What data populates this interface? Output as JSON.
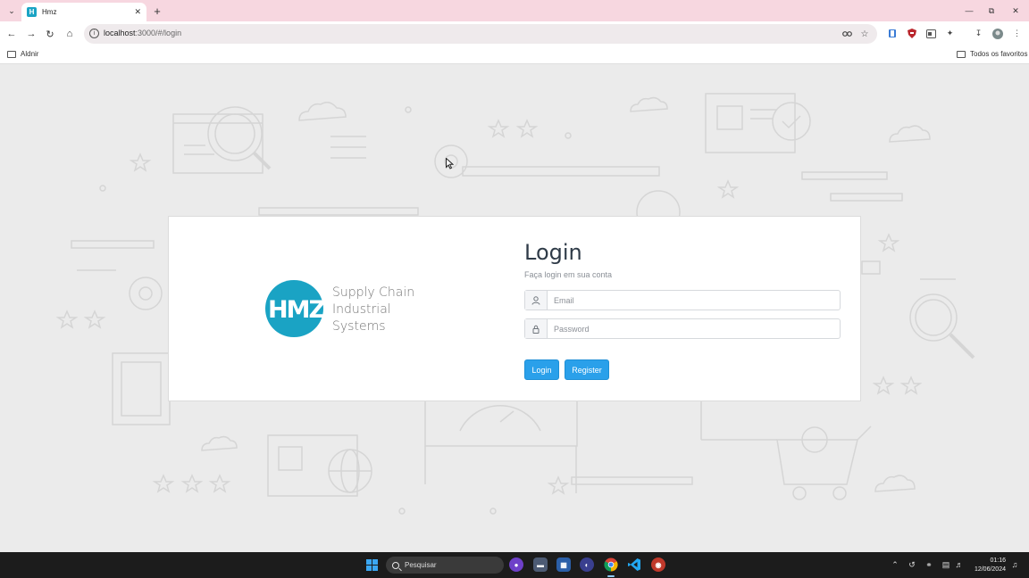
{
  "browser": {
    "tab_title": "Hmz",
    "tab_favicon": "H",
    "new_tab": "+",
    "url_host": "localhost",
    "url_rest": ":3000/#/login",
    "bookmark_left": "Aldnir",
    "bookmark_right": "Todos os favoritos",
    "icons": [
      "tab-search-icon",
      "close-icon",
      "back-arrow-icon",
      "forward-arrow-icon",
      "reload-icon",
      "home-icon",
      "site-info-icon",
      "password-key-icon",
      "star-icon",
      "extension-icon",
      "download-icon",
      "profile-avatar-icon",
      "menu-dots-icon"
    ]
  },
  "login_card": {
    "brand_logo_text": "HMZ",
    "brand_line1": "Supply Chain",
    "brand_line2": "Industrial",
    "brand_line3": "Systems",
    "title": "Login",
    "subtitle": "Faça login em sua conta",
    "email_placeholder": "Email",
    "email_value": "",
    "password_placeholder": "Password",
    "password_value": "",
    "login_button": "Login",
    "register_button": "Register"
  },
  "taskbar": {
    "search_label": "Pesquisar",
    "time": "01:16",
    "date": "12/06/2024"
  },
  "colors": {
    "tab_strip": "#f7d7e0",
    "brand_teal": "#1aa3c4",
    "primary_button": "#2aa0ea",
    "title_text": "#2f3b48",
    "page_background": "#ebebeb"
  }
}
